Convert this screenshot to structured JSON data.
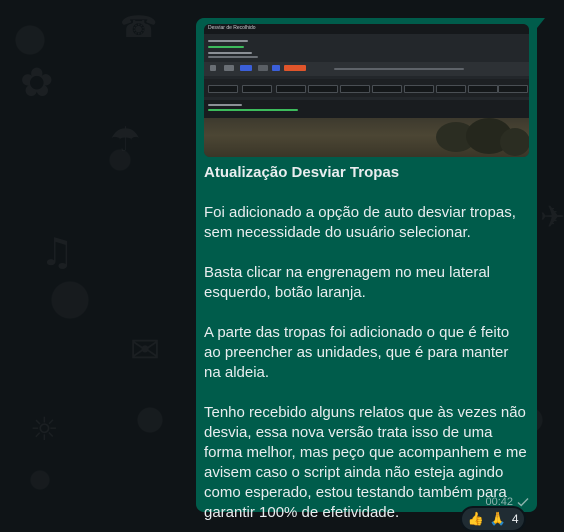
{
  "message": {
    "attachment": {
      "title": "Desviar de Recolhido",
      "thumbnail_kind": "screenshot"
    },
    "heading": "Atualização Desviar Tropas",
    "paragraphs": [
      "Foi adicionado a opção de auto desviar tropas, sem necessidade do usuário selecionar.",
      "Basta clicar na engrenagem no meu lateral esquerdo, botão laranja.",
      "A parte das tropas foi adicionado o que é feito ao preencher as unidades, que é para manter na aldeia.",
      "Tenho recebido alguns relatos que às vezes não desvia, essa nova versão trata isso de uma forma melhor, mas peço que acompanhem e me avisem caso o script ainda não esteja agindo como esperado, estou testando também para garantir 100% de efetividade."
    ],
    "time": "00:42",
    "status_icon": "single-check-icon",
    "colors": {
      "bubble": "#005c4b",
      "background": "#0f1417",
      "text": "#e9edef"
    }
  },
  "reactions": {
    "emojis": [
      "👍",
      "🙏"
    ],
    "count": "4"
  }
}
